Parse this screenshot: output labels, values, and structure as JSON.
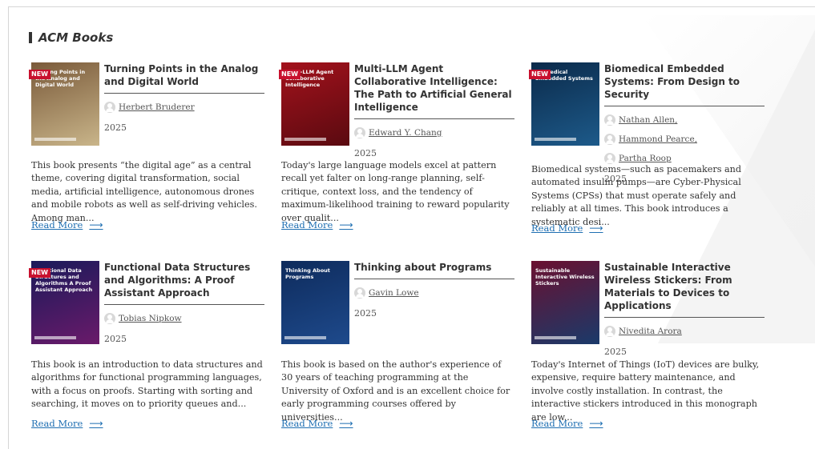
{
  "section": {
    "title": "ACM Books"
  },
  "colors": {
    "accent_link": "#1f6fb2",
    "badge": "#c8102e"
  },
  "books": [
    {
      "is_new": true,
      "badge": "NEW",
      "title": "Turning Points in the Analog and Digital World",
      "cover_text": "Turning Points in the Analog and Digital World",
      "cover_colors": [
        "#7a5a3a",
        "#c9b58a"
      ],
      "authors": [
        "Herbert Bruderer"
      ],
      "year": "2025",
      "description": "This book presents “the digital age” as a central theme, covering digital transformation, social media, artificial intelligence, autonomous drones and mobile robots as well as self-driving vehicles. Among man...",
      "read_more": "Read More"
    },
    {
      "is_new": true,
      "badge": "NEW",
      "title": "Multi-LLM Agent Collaborative Intelligence: The Path to Artificial General Intelligence",
      "cover_text": "Multi-LLM Agent Collaborative Intelligence",
      "cover_colors": [
        "#a3121c",
        "#5a0a10"
      ],
      "authors": [
        "Edward Y. Chang"
      ],
      "year": "2025",
      "description": "Today's large language models excel at pattern recall yet falter on long-range planning, self-critique, context loss, and the tendency of maximum-likelihood training to reward popularity over qualit...",
      "read_more": "Read More"
    },
    {
      "is_new": true,
      "badge": "NEW",
      "title": "Biomedical Embedded Systems: From Design to Security",
      "cover_text": "Biomedical Embedded Systems",
      "cover_colors": [
        "#0b2a4a",
        "#1d5a8a"
      ],
      "authors": [
        "Nathan Allen,",
        "Hammond Pearce,",
        "Partha Roop"
      ],
      "year": "2025",
      "description": "Biomedical systems—such as pacemakers and automated insulin pumps—are Cyber-Physical Systems (CPSs) that must operate safely and reliably at all times. This book introduces a systematic desi...",
      "read_more": "Read More"
    },
    {
      "is_new": true,
      "badge": "NEW",
      "title": "Functional Data Structures and Algorithms: A Proof Assistant Approach",
      "cover_text": "Functional Data Structures and Algorithms A Proof Assistant Approach",
      "cover_colors": [
        "#1a1a5a",
        "#6a1a6a"
      ],
      "authors": [
        "Tobias Nipkow"
      ],
      "year": "2025",
      "description": "This book is an introduction to data structures and algorithms for functional programming languages, with a focus on proofs. Starting with sorting and searching, it moves on to priority queues and...",
      "read_more": "Read More"
    },
    {
      "is_new": false,
      "badge": "",
      "title": "Thinking about Programs",
      "cover_text": "Thinking About Programs",
      "cover_colors": [
        "#0e2b5c",
        "#1e4a8c"
      ],
      "authors": [
        "Gavin Lowe"
      ],
      "year": "2025",
      "description": "This book is based on the author's experience of 30 years of teaching programming at the University of Oxford and is an excellent choice for early programming courses offered by universities...",
      "read_more": "Read More"
    },
    {
      "is_new": false,
      "badge": "",
      "title": "Sustainable Interactive Wireless Stickers: From Materials to Devices to Applications",
      "cover_text": "Sustainable Interactive Wireless Stickers",
      "cover_colors": [
        "#6a1030",
        "#1a3a6a"
      ],
      "authors": [
        "Nivedita Arora"
      ],
      "year": "2025",
      "description": "Today's Internet of Things (IoT) devices are bulky, expensive, require battery maintenance, and involve costly installation. In contrast, the interactive stickers introduced in this monograph are low...",
      "read_more": "Read More"
    }
  ]
}
